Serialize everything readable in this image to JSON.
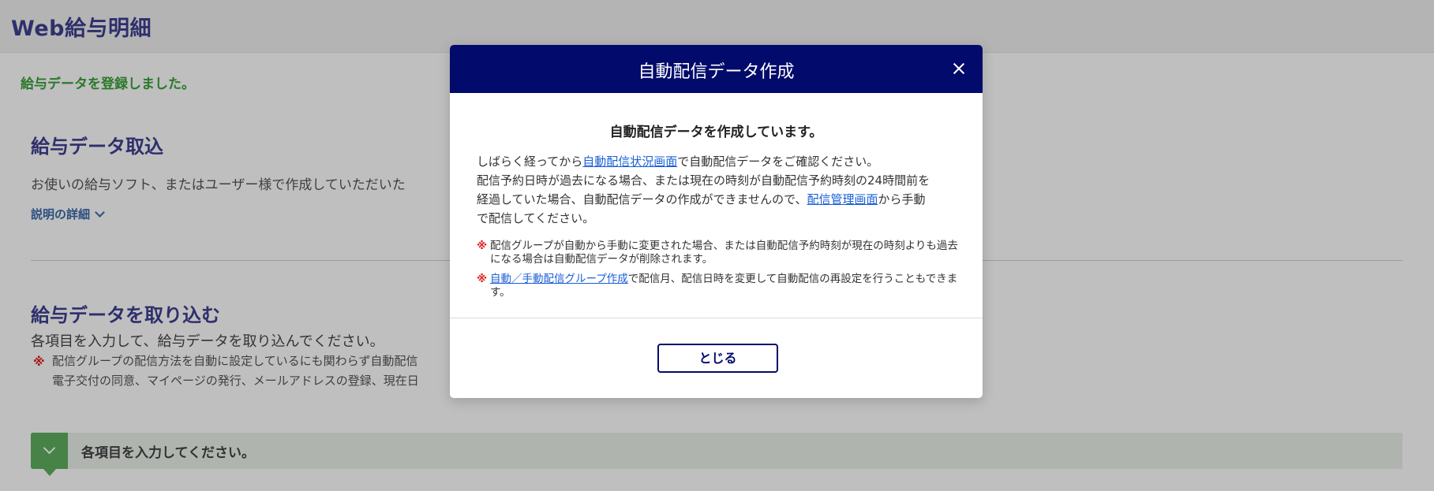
{
  "app": {
    "title": "Web給与明細"
  },
  "flash": {
    "message": "給与データを登録しました。"
  },
  "import_section": {
    "title": "給与データ取込",
    "description": "お使いの給与ソフト、またはユーザー様で作成していただいた",
    "detail_link": "説明の詳細"
  },
  "form_section": {
    "title": "給与データを取り込む",
    "instruction": "各項目を入力して、給与データを取り込んでください。",
    "note_mark": "※",
    "note_line1": "配信グループの配信方法を自動に設定しているにも関わらず自動配信",
    "note_line2": "電子交付の同意、マイページの発行、メールアドレスの登録、現在日"
  },
  "step": {
    "text": "各項目を入力してください。"
  },
  "modal": {
    "title": "自動配信データ作成",
    "heading": "自動配信データを作成しています。",
    "body": {
      "p1_pre": "しばらく経ってから",
      "p1_link": "自動配信状況画面",
      "p1_post": "で自動配信データをご確認ください。",
      "p2_line1": "配信予約日時が過去になる場合、または現在の時刻が自動配信予約時刻の24時間前を",
      "p2_line2_pre": "経過していた場合、自動配信データの作成ができませんので、",
      "p2_link": "配信管理画面",
      "p2_line2_post": "から手動",
      "p2_line3": "で配信してください。"
    },
    "notes": {
      "mark": "※",
      "note1": "配信グループが自動から手動に変更された場合、または自動配信予約時刻が現在の時刻よりも過去になる場合は自動配信データが削除されます。",
      "note2_link": "自動／手動配信グループ作成",
      "note2_post": "で配信月、配信日時を変更して自動配信の再設定を行うこともできます。"
    },
    "close_button": "とじる"
  }
}
